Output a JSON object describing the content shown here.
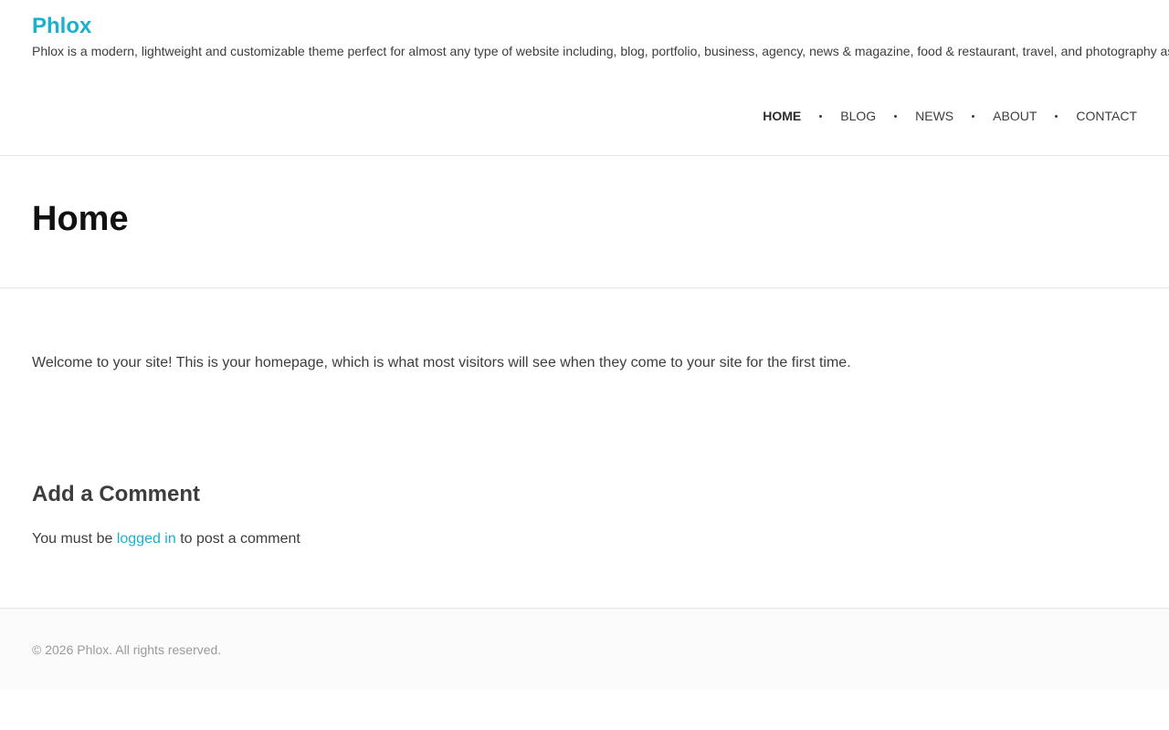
{
  "site": {
    "title": "Phlox",
    "tagline": "Phlox is a modern, lightweight and customizable theme perfect for almost any type of website including, blog, portfolio, business, agency, news & magazine, food & restaurant, travel, and photography as well"
  },
  "nav": {
    "items": [
      {
        "label": "HOME",
        "active": true
      },
      {
        "label": "BLOG",
        "active": false
      },
      {
        "label": "NEWS",
        "active": false
      },
      {
        "label": "ABOUT",
        "active": false
      },
      {
        "label": "CONTACT",
        "active": false
      }
    ]
  },
  "page": {
    "title": "Home",
    "welcome": "Welcome to your site! This is your homepage, which is what most visitors will see when they come to your site for the first time."
  },
  "comments": {
    "heading": "Add a Comment",
    "prefix": "You must be ",
    "login_link": "logged in",
    "suffix": " to post a comment"
  },
  "footer": {
    "copyright": "© 2026 Phlox. All rights reserved."
  },
  "colors": {
    "accent": "#1bb0ce",
    "text": "#3d3d3d",
    "border": "#e6e6e6"
  }
}
